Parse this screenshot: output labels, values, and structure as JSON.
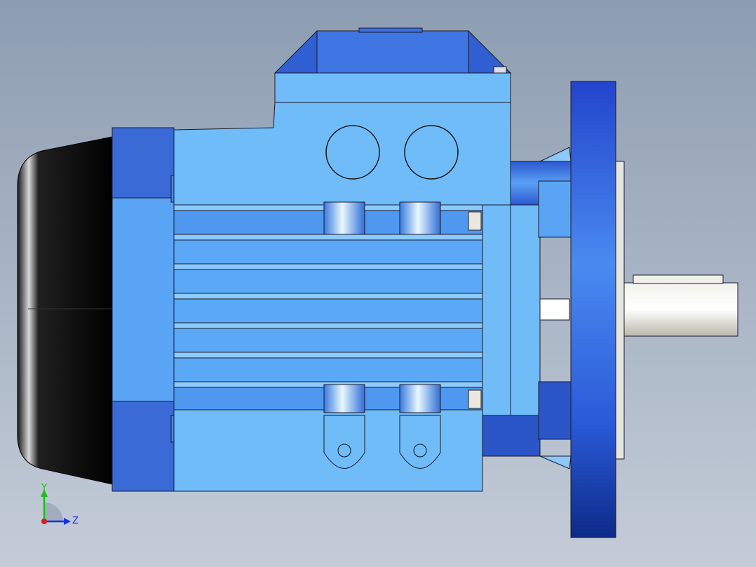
{
  "viewport": {
    "background_top": "#8d9db1",
    "background_bottom": "#c4ccd8"
  },
  "model": {
    "body_color": "#6fbcf9",
    "dark_blue": "#2f5fd0",
    "end_cap_color": "#0a0a0a",
    "shaft_color": "#e6e6dc",
    "outline_color": "#1a1a2a"
  },
  "triad": {
    "y_label": "Y",
    "z_label": "Z",
    "y_color": "#18c018",
    "z_color": "#1830e0",
    "x_color": "#e01818"
  }
}
